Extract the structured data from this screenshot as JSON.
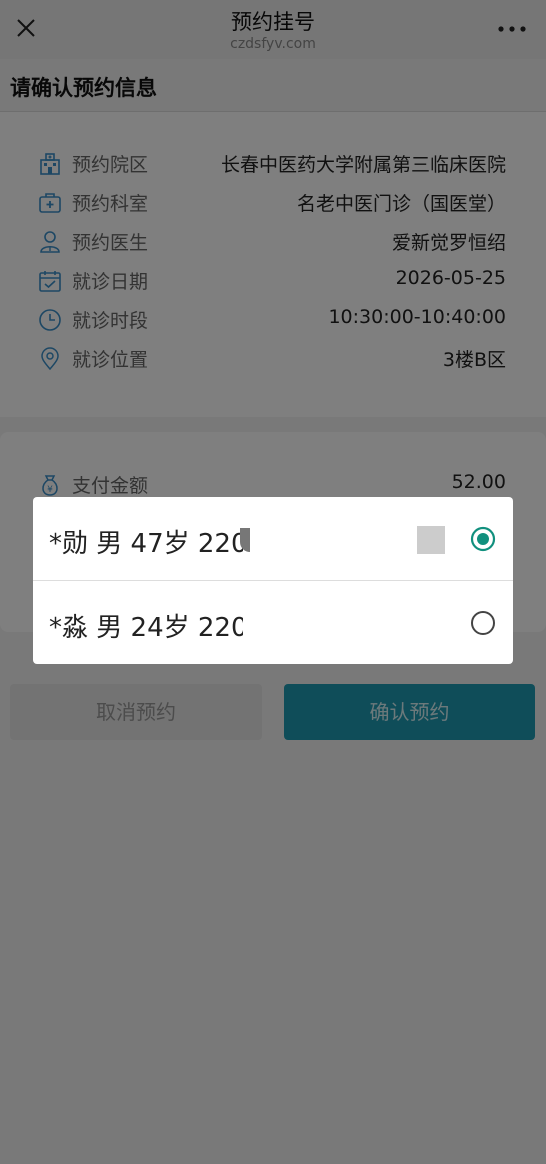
{
  "header": {
    "title": "预约挂号",
    "domain": "czdsfyv.com"
  },
  "section_title": "请确认预约信息",
  "info_rows": [
    {
      "icon": "hospital-icon",
      "label": "预约院区",
      "value": "长春中医药大学附属第三临床医院"
    },
    {
      "icon": "medical-kit-icon",
      "label": "预约科室",
      "value": "名老中医门诊（国医堂）"
    },
    {
      "icon": "doctor-icon",
      "label": "预约医生",
      "value": "爱新觉罗恒绍"
    },
    {
      "icon": "calendar-icon",
      "label": "就诊日期",
      "value": "2026-05-25"
    },
    {
      "icon": "clock-icon",
      "label": "就诊时段",
      "value": "10:30:00-10:40:00"
    },
    {
      "icon": "location-icon",
      "label": "就诊位置",
      "value": "3楼B区"
    }
  ],
  "payment": {
    "icon": "money-bag-icon",
    "label": "支付金额",
    "value": "52.00"
  },
  "buttons": {
    "cancel": "取消预约",
    "confirm": "确认预约"
  },
  "patient_dialog": {
    "options": [
      {
        "text": "*勋 男 47岁 220",
        "selected": true
      },
      {
        "text": "*淼 男 24岁 220",
        "selected": false
      }
    ]
  },
  "colors": {
    "accent": "#1f9bb2",
    "radio_selected": "#11907e",
    "icon_blue": "#3a8fc9"
  }
}
